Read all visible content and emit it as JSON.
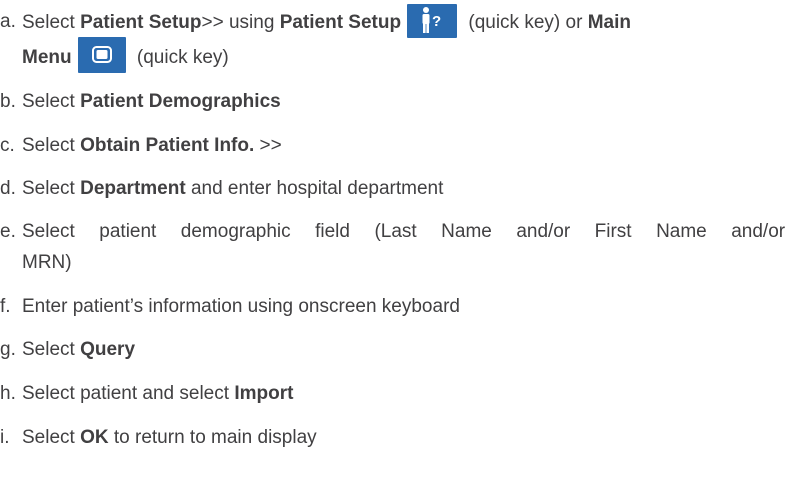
{
  "steps": {
    "a": {
      "marker": "a.",
      "select": "Select",
      "patient_setup": "Patient Setup",
      "arrows": ">>",
      "using": "using",
      "patient_setup_2": "Patient Setup",
      "quick_key_1": "(quick key) or",
      "main": "Main",
      "menu": "Menu",
      "quick_key_2": "(quick key)",
      "icon_setup": "patient-setup-icon",
      "icon_menu": "main-menu-icon"
    },
    "b": {
      "marker": "b.",
      "select": "Select",
      "bold": "Patient Demographics"
    },
    "c": {
      "marker": "c.",
      "select": "Select",
      "bold": "Obtain Patient Info.",
      "suffix": ">>"
    },
    "d": {
      "marker": "d.",
      "select": "Select",
      "bold": "Department",
      "suffix": "and enter hospital department"
    },
    "e": {
      "marker": "e.",
      "line1_words": [
        "Select",
        "patient",
        "demographic",
        "field",
        "(Last",
        "Name",
        "and/or",
        "First",
        "Name",
        "and/or"
      ],
      "line2": "MRN)"
    },
    "f": {
      "marker": "f.",
      "text": "Enter patient’s information using onscreen keyboard"
    },
    "g": {
      "marker": "g.",
      "select": "Select",
      "bold": "Query"
    },
    "h": {
      "marker": "h.",
      "prefix": "Select patient and select",
      "bold": "Import"
    },
    "i": {
      "marker": "i.",
      "select": "Select",
      "bold": "OK",
      "suffix": "to return to main display"
    }
  },
  "colors": {
    "text": "#414042",
    "icon_bg": "#2a6bb0"
  }
}
